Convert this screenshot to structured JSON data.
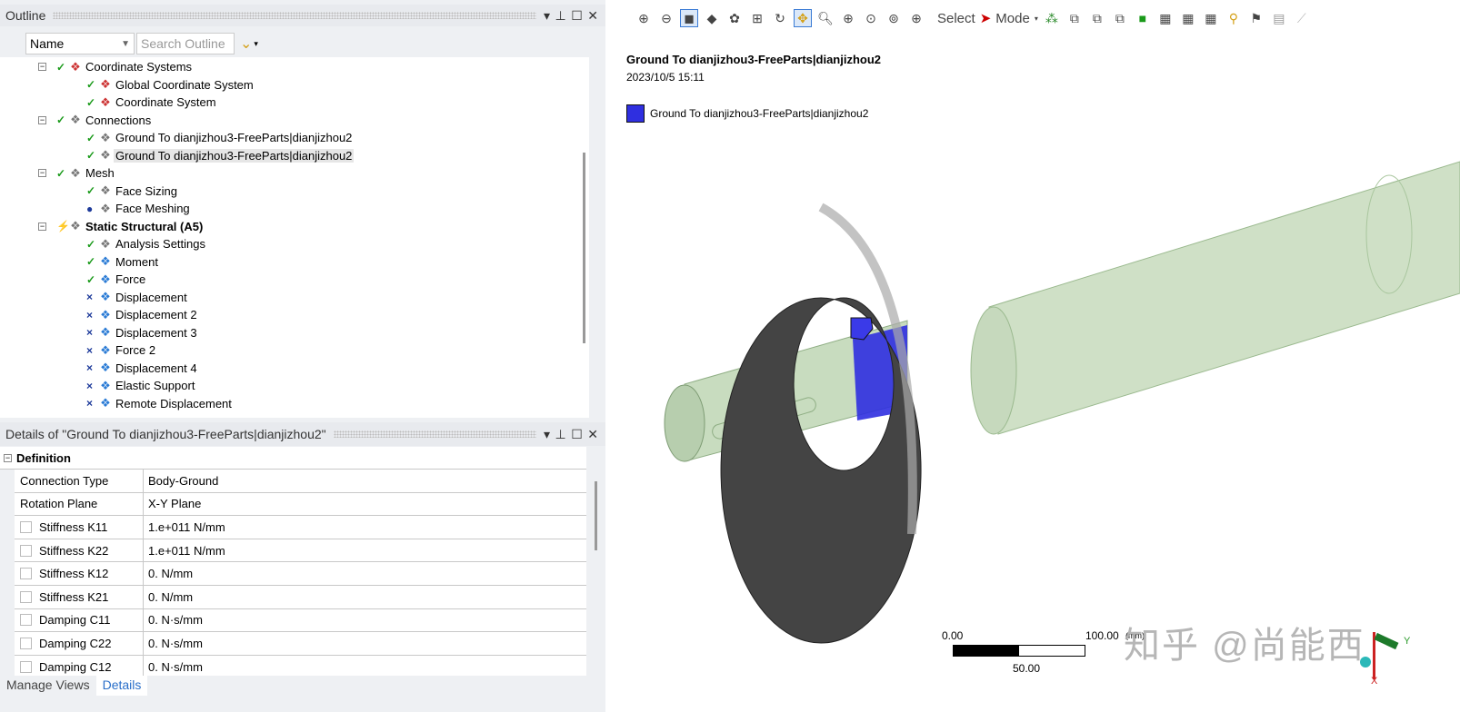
{
  "outline": {
    "title": "Outline",
    "name_select": "Name",
    "search_placeholder": "Search Outline",
    "items": [
      {
        "label": "Coordinate Systems",
        "level": 1,
        "status": "check",
        "icon": "coordinate-systems-icon",
        "expand": "-"
      },
      {
        "label": "Global Coordinate System",
        "level": 2,
        "status": "check",
        "icon": "coordinate-icon"
      },
      {
        "label": "Coordinate System",
        "level": 2,
        "status": "check",
        "icon": "coordinate-icon"
      },
      {
        "label": "Connections",
        "level": 1,
        "status": "check",
        "icon": "connections-icon",
        "expand": "-"
      },
      {
        "label": "Ground To dianjizhou3-FreeParts|dianjizhou2",
        "level": 2,
        "status": "check",
        "icon": "joint-icon"
      },
      {
        "label": "Ground To dianjizhou3-FreeParts|dianjizhou2",
        "level": 2,
        "status": "check",
        "icon": "joint-icon",
        "selected": true
      },
      {
        "label": "Mesh",
        "level": 1,
        "status": "check",
        "icon": "mesh-icon",
        "expand": "-"
      },
      {
        "label": "Face Sizing",
        "level": 2,
        "status": "check",
        "icon": "face-sizing-icon"
      },
      {
        "label": "Face Meshing",
        "level": 2,
        "status": "minus",
        "icon": "face-meshing-icon"
      },
      {
        "label": "Static Structural (A5)",
        "level": 1,
        "status": "bolt",
        "icon": "static-structural-icon",
        "expand": "-",
        "bold": true
      },
      {
        "label": "Analysis Settings",
        "level": 2,
        "status": "check",
        "icon": "analysis-settings-icon"
      },
      {
        "label": "Moment",
        "level": 2,
        "status": "check",
        "icon": "moment-icon"
      },
      {
        "label": "Force",
        "level": 2,
        "status": "check",
        "icon": "force-icon"
      },
      {
        "label": "Displacement",
        "level": 2,
        "status": "x",
        "icon": "displacement-icon"
      },
      {
        "label": "Displacement 2",
        "level": 2,
        "status": "x",
        "icon": "displacement-icon"
      },
      {
        "label": "Displacement 3",
        "level": 2,
        "status": "x",
        "icon": "displacement-icon"
      },
      {
        "label": "Force 2",
        "level": 2,
        "status": "x",
        "icon": "force-icon"
      },
      {
        "label": "Displacement 4",
        "level": 2,
        "status": "x",
        "icon": "displacement-icon"
      },
      {
        "label": "Elastic Support",
        "level": 2,
        "status": "x",
        "icon": "elastic-support-icon"
      },
      {
        "label": "Remote Displacement",
        "level": 2,
        "status": "x",
        "icon": "remote-displacement-icon"
      }
    ]
  },
  "details": {
    "title": "Details of \"Ground To dianjizhou3-FreeParts|dianjizhou2\"",
    "section": "Definition",
    "rows": [
      {
        "name": "Connection Type",
        "value": "Body-Ground",
        "checkbox": false
      },
      {
        "name": "Rotation Plane",
        "value": "X-Y Plane",
        "checkbox": false
      },
      {
        "name": "Stiffness K11",
        "value": "1.e+011 N/mm",
        "checkbox": true
      },
      {
        "name": "Stiffness K22",
        "value": "1.e+011 N/mm",
        "checkbox": true
      },
      {
        "name": "Stiffness K12",
        "value": "0. N/mm",
        "checkbox": true
      },
      {
        "name": "Stiffness K21",
        "value": "0. N/mm",
        "checkbox": true
      },
      {
        "name": "Damping C11",
        "value": "0. N·s/mm",
        "checkbox": true
      },
      {
        "name": "Damping C22",
        "value": "0. N·s/mm",
        "checkbox": true
      },
      {
        "name": "Damping C12",
        "value": "0. N·s/mm",
        "checkbox": true
      }
    ]
  },
  "tabs": [
    "Manage Views",
    "Details"
  ],
  "toolbar": {
    "select": "Select",
    "mode": "Mode"
  },
  "viewport": {
    "title": "Ground To dianjizhou3-FreeParts|dianjizhou2",
    "date": "2023/10/5 15:11",
    "legend": "Ground To dianjizhou3-FreeParts|dianjizhou2",
    "legend_color": "#2f2fe0",
    "scale": {
      "min": "0.00",
      "max": "100.00",
      "unit": "(mm)",
      "mid": "50.00"
    },
    "axes": {
      "x": "X",
      "y": "Y"
    },
    "watermark": "知乎 @尚能西"
  }
}
